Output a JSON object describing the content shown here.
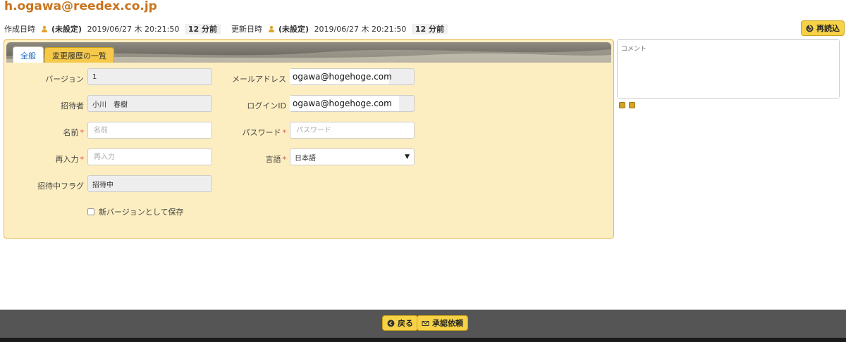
{
  "header": {
    "title": "h.ogawa@reedex.co.jp",
    "created": {
      "label": "作成日時",
      "user": "(未設定)",
      "datetime": "2019/06/27 木 20:21:50",
      "ago": "12 分前"
    },
    "updated": {
      "label": "更新日時",
      "user": "(未設定)",
      "datetime": "2019/06/27 木 20:21:50",
      "ago": "12 分前"
    },
    "reload_label": "再読込"
  },
  "tabs": [
    {
      "label": "全般",
      "active": true
    },
    {
      "label": "変更履歴の一覧",
      "active": false
    }
  ],
  "form": {
    "version": {
      "label": "バージョン",
      "value": "1"
    },
    "inviter": {
      "label": "招待者",
      "value": "小川　春樹"
    },
    "name": {
      "label": "名前",
      "required": "*",
      "placeholder": "名前"
    },
    "reenter": {
      "label": "再入力",
      "required": "*",
      "placeholder": "再入力"
    },
    "inviting_flag": {
      "label": "招待中フラグ",
      "value": "招待中"
    },
    "email": {
      "label": "メールアドレス",
      "value": "ogawa@hogehoge.com"
    },
    "login_id": {
      "label": "ログインID",
      "value": "ogawa@hogehoge.com"
    },
    "password": {
      "label": "パスワード",
      "required": "*",
      "placeholder": "パスワード"
    },
    "language": {
      "label": "言語",
      "required": "*",
      "value": "日本語"
    },
    "save_new_version": {
      "label": "新バージョンとして保存",
      "checked": false
    }
  },
  "comment": {
    "placeholder": "コメント"
  },
  "footer": {
    "back_label": "戻る",
    "approval_label": "承認依頼"
  },
  "colors": {
    "title": "#c8741d",
    "panel_bg": "#fdeec1",
    "button_bg": "#f7d246",
    "footer_bg": "#555555",
    "required": "#d9534f"
  }
}
